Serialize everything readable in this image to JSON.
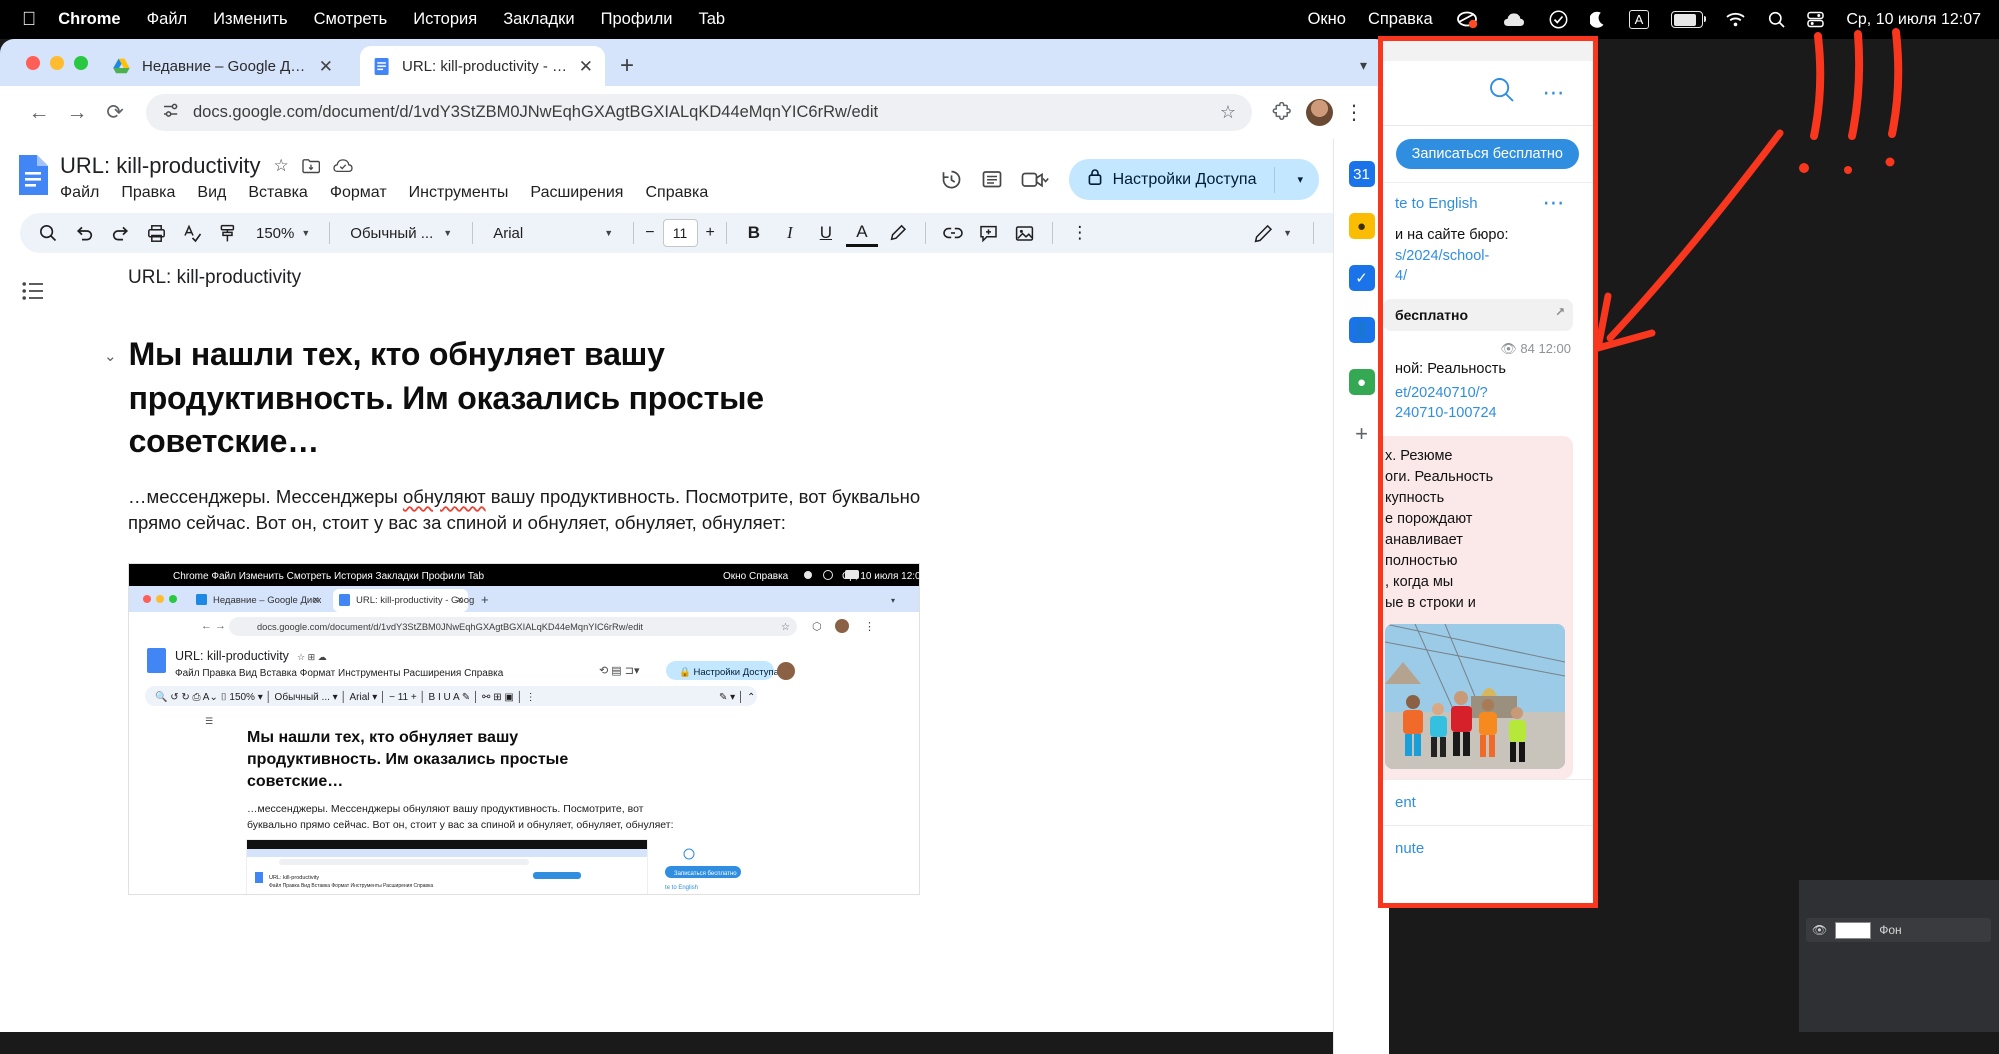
{
  "menubar": {
    "apple_icon": "apple-icon",
    "items": [
      "Chrome",
      "Файл",
      "Изменить",
      "Смотреть",
      "История",
      "Закладки",
      "Профили",
      "Tab"
    ],
    "right_items": [
      "Окно",
      "Справка"
    ],
    "status_icons": [
      "screen-record-icon",
      "cloud-icon",
      "check-circle-icon",
      "moon-icon",
      "keyboard-layout-a-icon",
      "battery-icon",
      "wifi-icon",
      "search-icon",
      "control-center-icon"
    ],
    "keyboard_layout": "A",
    "clock": "Ср, 10 июля  12:07"
  },
  "browser": {
    "tabs": [
      {
        "title": "Недавние – Google Диск",
        "favicon": "google-drive-icon",
        "active": false
      },
      {
        "title": "URL: kill-productivity - Googl",
        "favicon": "google-docs-icon",
        "active": true
      }
    ],
    "new_tab_label": "+",
    "tab_list_chevron": "▾",
    "back": "←",
    "forward": "→",
    "reload": "⟳",
    "url": "docs.google.com/document/d/1vdY3StZBM0JNwEqhGXAgtBGXIALqKD44eMqnYIC6rRw/edit",
    "site_info_icon": "site-settings-icon",
    "bookmark_icon": "star-icon",
    "extensions_icon": "puzzle-icon",
    "profile_icon": "profile-avatar",
    "menu_icon": "kebab-menu-icon"
  },
  "docs": {
    "app_icon": "google-docs-logo",
    "title": "URL: kill-productivity",
    "title_icons": [
      "star-icon",
      "move-to-folder-icon",
      "cloud-saved-icon"
    ],
    "menus": [
      "Файл",
      "Правка",
      "Вид",
      "Вставка",
      "Формат",
      "Инструменты",
      "Расширения",
      "Справка"
    ],
    "header_icons": [
      "version-history-icon",
      "comment-history-icon",
      "meet-camera-icon"
    ],
    "share_label": "Настройки Доступа",
    "share_lock_icon": "lock-icon",
    "share_caret": "▾",
    "avatar": "user-avatar",
    "toolbar": {
      "search_icon": "search-icon",
      "undo_icon": "undo-icon",
      "redo_icon": "redo-icon",
      "print_icon": "print-icon",
      "spellcheck_icon": "spellcheck-icon",
      "paint_format_icon": "paint-format-icon",
      "zoom": "150%",
      "style": "Обычный ...",
      "font": "Arial",
      "font_size": "11",
      "decrease": "−",
      "increase": "+",
      "bold": "B",
      "italic": "I",
      "underline": "U",
      "text_color": "A",
      "highlight_icon": "highlight-pen-icon",
      "link_icon": "link-icon",
      "comment_icon": "add-comment-icon",
      "image_icon": "insert-image-icon",
      "more_icon": "more-options-icon",
      "edit_mode_icon": "edit-pencil-icon",
      "edit_mode_caret": "▾",
      "collapse_icon": "chevron-up-icon"
    },
    "outline_icon": "document-outline-icon",
    "body": {
      "url_line": "URL: kill-productivity",
      "heading_chevron": "⌄",
      "heading": "Мы нашли тех, кто обнуляет вашу продуктивность. Им оказались простые советские…",
      "paragraph_pre": "…мессенджеры. Мессенджеры ",
      "paragraph_spell": "обнуляют",
      "paragraph_post": " вашу продуктивность. Посмотрите, вот буквально прямо сейчас. Вот он, стоит у вас за спиной и обнуляет, обнуляет, обнуляет:",
      "nested_screenshot_alt": "recursive-screenshot-image"
    },
    "rail_icons": [
      "google-calendar-icon",
      "google-keep-icon",
      "google-tasks-icon",
      "google-contacts-icon",
      "google-maps-icon",
      "add-addon-icon"
    ],
    "next_page_icon": "›"
  },
  "telegram": {
    "search_icon": "search-icon",
    "more_icon": "more-menu-icon",
    "cta_label": "Записаться бесплатно",
    "translate_label": "te to English",
    "post_more_icon": "post-more-icon",
    "post_lines": [
      "и на сайте бюро:",
      "s/2024/school-",
      "4/"
    ],
    "quote_label": "бесплатно",
    "quote_arrow": "↗",
    "views_icon": "eye-icon",
    "views": "84",
    "time": "12:00",
    "second_title": "ной: Реальность",
    "second_links": [
      "et/20240710/?",
      "240710-100724"
    ],
    "bubble_lines": [
      "х. Резюме",
      "оги. Реальность",
      "купность",
      "е порождают",
      "анавливает",
      "полностью",
      ", когда мы",
      "ые в строки и"
    ],
    "photo_alt": "marathon-runners-photo",
    "footer_comment": "ent",
    "footer_mute": "nute"
  },
  "desktop": {
    "layer_label": "Фон",
    "eye_icon": "visibility-icon"
  },
  "colors": {
    "accent_blue": "#2f8ee0",
    "docs_blue": "#1a73e8",
    "share_bg": "#c2e7ff",
    "annotation_red": "#f8371e",
    "bubble_pink": "#fbe9ea"
  }
}
